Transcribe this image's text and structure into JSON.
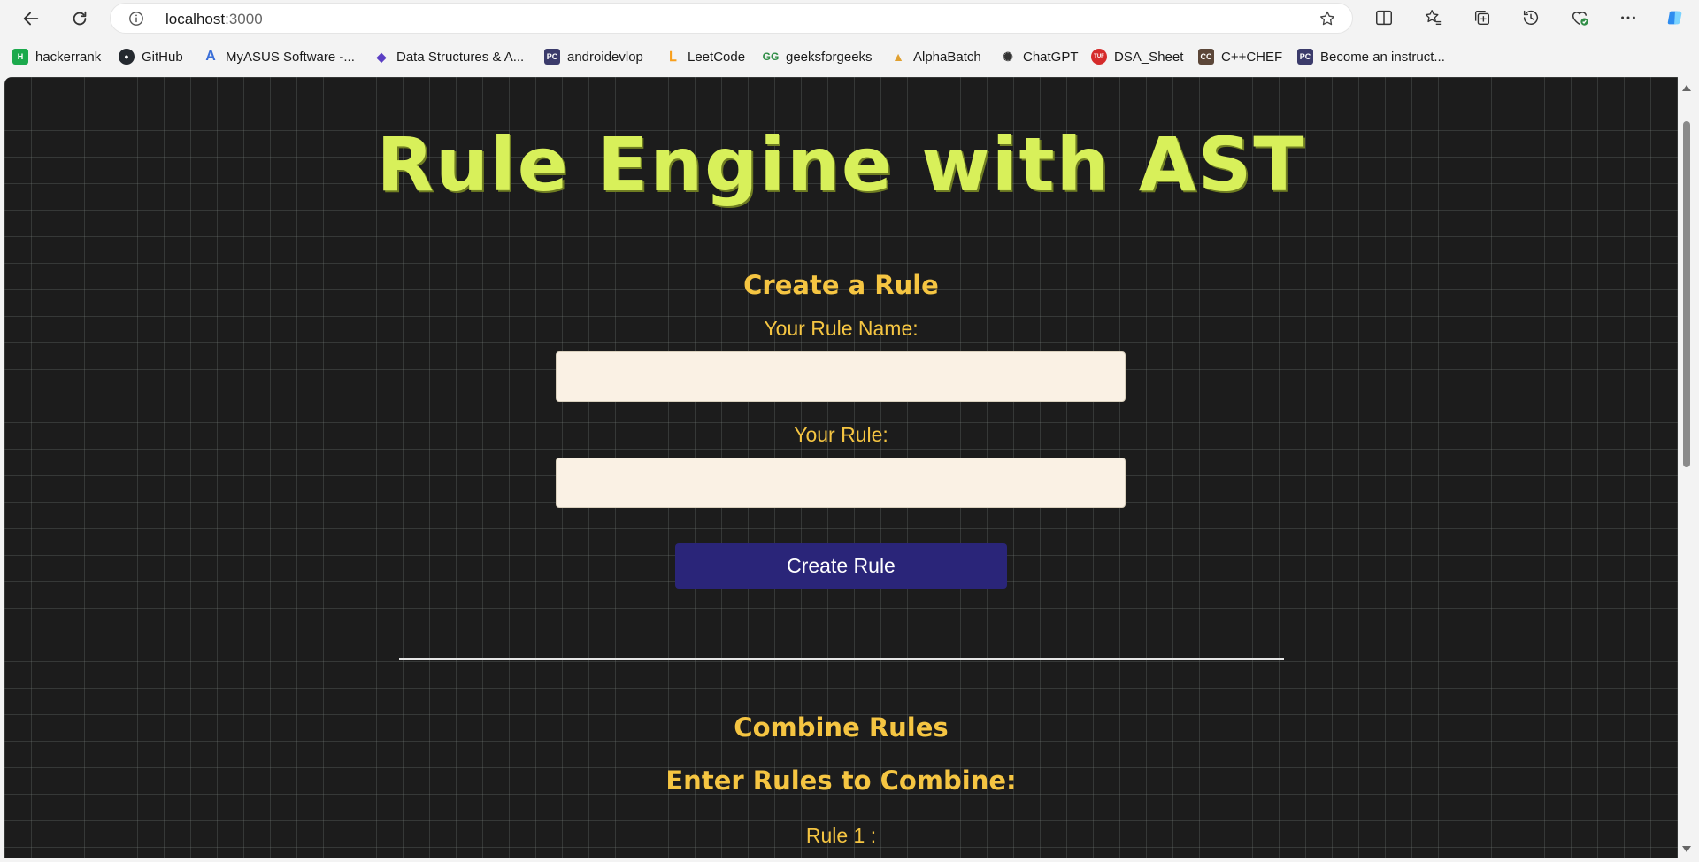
{
  "browser": {
    "url_host": "localhost",
    "url_port": ":3000"
  },
  "bookmarks": [
    {
      "label": "hackerrank",
      "icon": "hackerrank-icon",
      "color": "#1ba94c"
    },
    {
      "label": "GitHub",
      "icon": "github-icon",
      "color": "#24292f"
    },
    {
      "label": "MyASUS Software -...",
      "icon": "asus-icon",
      "color": "#3b6fd8"
    },
    {
      "label": "Data Structures & A...",
      "icon": "code-diamond-icon",
      "color": "#5b3fc4"
    },
    {
      "label": "androidevlop",
      "icon": "pycharm-icon",
      "color": "#3b3b6b"
    },
    {
      "label": "LeetCode",
      "icon": "leetcode-icon",
      "color": "#f89f1b"
    },
    {
      "label": "geeksforgeeks",
      "icon": "gfg-icon",
      "color": "#2f8d46"
    },
    {
      "label": "AlphaBatch",
      "icon": "alphabatch-icon",
      "color": "#e0a030"
    },
    {
      "label": "ChatGPT",
      "icon": "chatgpt-icon",
      "color": "#333333"
    },
    {
      "label": "DSA_Sheet",
      "icon": "dsa-sheet-icon",
      "color": "#d52b2b"
    },
    {
      "label": "C++CHEF",
      "icon": "codechef-icon",
      "color": "#5b4638"
    },
    {
      "label": "Become an instruct...",
      "icon": "pycharm-icon",
      "color": "#3b3b6b"
    }
  ],
  "page": {
    "title": "Rule Engine with AST",
    "create": {
      "heading": "Create a Rule",
      "name_label": "Your Rule Name:",
      "name_value": "",
      "rule_label": "Your Rule:",
      "rule_value": "",
      "button": "Create Rule"
    },
    "combine": {
      "heading": "Combine Rules",
      "subheading": "Enter Rules to Combine:",
      "rule1_label": "Rule 1 :"
    }
  },
  "colors": {
    "title": "#d8f05a",
    "headings": "#f5c542",
    "button_bg": "#2a2579",
    "input_bg": "#faf1e4",
    "page_bg": "#1c1c1c"
  }
}
